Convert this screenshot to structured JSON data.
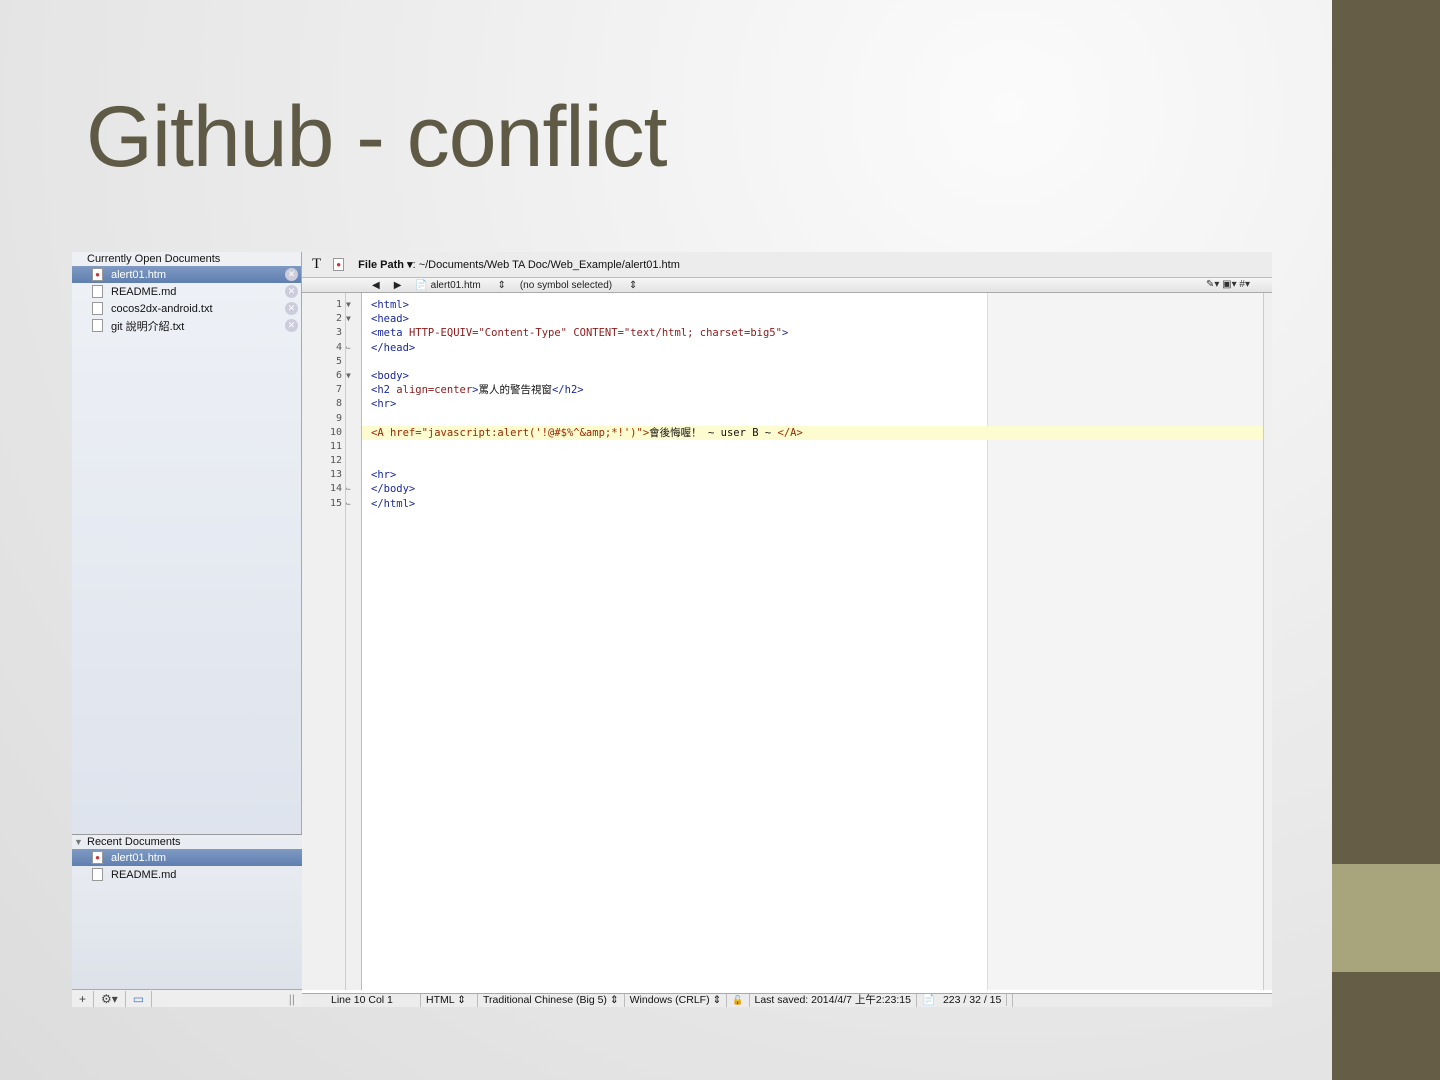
{
  "slide": {
    "title": "Github - conflict",
    "colors": {
      "strip": "#665d47",
      "strip_accent": "#a8a47c",
      "title": "#5f5a45"
    }
  },
  "sidebar": {
    "open_header": "Currently Open Documents",
    "open_docs": [
      {
        "name": "alert01.htm",
        "icon": "html-file-icon",
        "selected": true
      },
      {
        "name": "README.md",
        "icon": "markdown-file-icon",
        "selected": false
      },
      {
        "name": "cocos2dx-android.txt",
        "icon": "text-file-icon",
        "selected": false
      },
      {
        "name": "git 說明介紹.txt",
        "icon": "text-file-icon",
        "selected": false
      }
    ],
    "recent_header": "Recent Documents",
    "recent_docs": [
      {
        "name": "alert01.htm",
        "selected": true
      },
      {
        "name": "README.md",
        "selected": false
      }
    ],
    "footer": {
      "add": "+",
      "gear": "⚙▾",
      "panel": "▭",
      "grip": "||"
    }
  },
  "toolbar": {
    "text_icon": "T",
    "file_path_label": "File Path ▾",
    "file_path": ": ~/Documents/Web TA Doc/Web_Example/alert01.htm"
  },
  "navbar": {
    "back": "◀",
    "forward": "▶",
    "file": "alert01.htm",
    "symbol": "(no symbol selected)",
    "right": "✎▾  ▣▾  #▾"
  },
  "code": [
    {
      "n": "1",
      "fold": "▼",
      "tokens": [
        [
          "<html>",
          "t"
        ]
      ]
    },
    {
      "n": "2",
      "fold": "▼",
      "tokens": [
        [
          "<head>",
          "t"
        ]
      ]
    },
    {
      "n": "3",
      "fold": "",
      "tokens": [
        [
          "<meta ",
          "t"
        ],
        [
          "HTTP-EQUIV=",
          "a"
        ],
        [
          "\"Content-Type\" ",
          "s"
        ],
        [
          "CONTENT=",
          "a"
        ],
        [
          "\"text/html; charset=big5\"",
          "s"
        ],
        [
          ">",
          "t"
        ]
      ]
    },
    {
      "n": "4",
      "fold": "⌙",
      "tokens": [
        [
          "</head>",
          "t"
        ]
      ]
    },
    {
      "n": "5",
      "fold": "",
      "tokens": []
    },
    {
      "n": "6",
      "fold": "▼",
      "tokens": [
        [
          "<body>",
          "t"
        ]
      ]
    },
    {
      "n": "7",
      "fold": "",
      "tokens": [
        [
          "<h2 ",
          "t"
        ],
        [
          "align=center",
          "a"
        ],
        [
          ">",
          "t"
        ],
        [
          "罵人的警告視窗",
          "x"
        ],
        [
          "</h2>",
          "t"
        ]
      ]
    },
    {
      "n": "8",
      "fold": "",
      "tokens": [
        [
          "<hr>",
          "t"
        ]
      ]
    },
    {
      "n": "9",
      "fold": "",
      "tokens": []
    },
    {
      "n": "10",
      "fold": "",
      "highlight": true,
      "tokens": [
        [
          "<A href=\"javascript:alert('!@#$%^&amp;*!')\">",
          "r"
        ],
        [
          "會後悔喔！ ~ user B ~ ",
          "x"
        ],
        [
          "</A>",
          "r"
        ]
      ]
    },
    {
      "n": "11",
      "fold": "",
      "tokens": []
    },
    {
      "n": "12",
      "fold": "",
      "tokens": []
    },
    {
      "n": "13",
      "fold": "",
      "tokens": [
        [
          "<hr>",
          "t"
        ]
      ]
    },
    {
      "n": "14",
      "fold": "⌙",
      "tokens": [
        [
          "</body>",
          "t"
        ]
      ]
    },
    {
      "n": "15",
      "fold": "⌙",
      "tokens": [
        [
          "</html>",
          "t"
        ]
      ]
    }
  ],
  "status": {
    "position": "Line 10 Col 1",
    "language": "HTML ⇕",
    "encoding": "Traditional Chinese (Big 5) ⇕",
    "line_endings": "Windows (CRLF) ⇕",
    "lock": "🔓",
    "saved": "Last saved: 2014/4/7 上午2:23:15",
    "counts": "223 / 32 / 15"
  }
}
